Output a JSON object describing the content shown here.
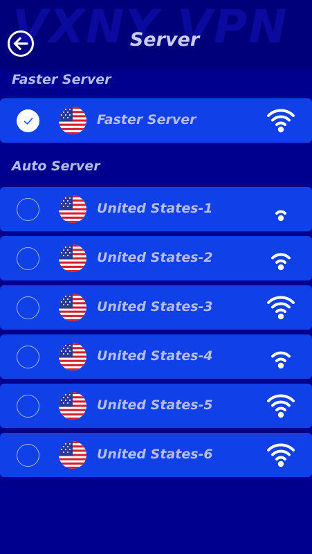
{
  "header": {
    "title": "Server",
    "watermark": "VXNY VPN",
    "back_icon": "arrow-left-circle-icon"
  },
  "sections": {
    "faster_label": "Faster Server",
    "auto_label": "Auto Server"
  },
  "faster_server": {
    "name": "Faster Server",
    "selected": true,
    "flag_icon": "us-flag-icon",
    "signal_level": 3
  },
  "servers": [
    {
      "name": "United States-1",
      "selected": false,
      "flag_icon": "us-flag-icon",
      "signal_level": 1
    },
    {
      "name": "United States-2",
      "selected": false,
      "flag_icon": "us-flag-icon",
      "signal_level": 2
    },
    {
      "name": "United States-3",
      "selected": false,
      "flag_icon": "us-flag-icon",
      "signal_level": 3
    },
    {
      "name": "United States-4",
      "selected": false,
      "flag_icon": "us-flag-icon",
      "signal_level": 2
    },
    {
      "name": "United States-5",
      "selected": false,
      "flag_icon": "us-flag-icon",
      "signal_level": 3
    },
    {
      "name": "United States-6",
      "selected": false,
      "flag_icon": "us-flag-icon",
      "signal_level": 3
    }
  ],
  "colors": {
    "background": "#00008f",
    "row": "#0f40e8",
    "text": "#b6bdec"
  }
}
